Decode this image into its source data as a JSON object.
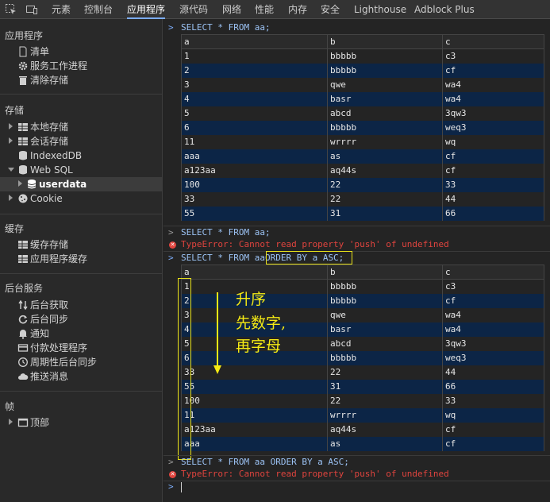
{
  "toolbar": {
    "tabs": [
      "元素",
      "控制台",
      "应用程序",
      "源代码",
      "网络",
      "性能",
      "内存",
      "安全",
      "Lighthouse",
      "Adblock Plus"
    ],
    "active_tab": "应用程序"
  },
  "sidebar": {
    "app_section": "应用程序",
    "app_items": [
      "清单",
      "服务工作进程",
      "清除存储"
    ],
    "storage_section": "存储",
    "storage_items": [
      "本地存储",
      "会话存储",
      "IndexedDB",
      "Web SQL",
      "userdata",
      "Cookie"
    ],
    "cache_section": "缓存",
    "cache_items": [
      "缓存存储",
      "应用程序缓存"
    ],
    "bg_section": "后台服务",
    "bg_items": [
      "后台获取",
      "后台同步",
      "通知",
      "付款处理程序",
      "周期性后台同步",
      "推送消息"
    ],
    "frames_section": "帧",
    "frames_items": [
      "顶部"
    ]
  },
  "console": {
    "prompt": ">",
    "cmd1": "SELECT * FROM aa;",
    "table1": {
      "headers": [
        "a",
        "b",
        "c"
      ],
      "rows": [
        [
          "1",
          "bbbbb",
          "c3"
        ],
        [
          "2",
          "bbbbb",
          "cf"
        ],
        [
          "3",
          "qwe",
          "wa4"
        ],
        [
          "4",
          "basr",
          "wa4"
        ],
        [
          "5",
          "abcd",
          "3qw3"
        ],
        [
          "6",
          "bbbbb",
          "weq3"
        ],
        [
          "11",
          "wrrrr",
          "wq"
        ],
        [
          "aaa",
          "as",
          "cf"
        ],
        [
          "a123aa",
          "aq44s",
          "cf"
        ],
        [
          "100",
          "22",
          "33"
        ],
        [
          "33",
          "22",
          "44"
        ],
        [
          "55",
          "31",
          "66"
        ]
      ]
    },
    "cmd2": "SELECT * FROM aa;",
    "error": "TypeError: Cannot read property 'push' of undefined",
    "cmd3_prefix": "SELECT * FROM aa",
    "cmd3_highlight": "ORDER BY a ASC;",
    "table2": {
      "headers": [
        "a",
        "b",
        "c"
      ],
      "rows": [
        [
          "1",
          "bbbbb",
          "c3"
        ],
        [
          "2",
          "bbbbb",
          "cf"
        ],
        [
          "3",
          "qwe",
          "wa4"
        ],
        [
          "4",
          "basr",
          "wa4"
        ],
        [
          "5",
          "abcd",
          "3qw3"
        ],
        [
          "6",
          "bbbbb",
          "weq3"
        ],
        [
          "33",
          "22",
          "44"
        ],
        [
          "55",
          "31",
          "66"
        ],
        [
          "100",
          "22",
          "33"
        ],
        [
          "11",
          "wrrrr",
          "wq"
        ],
        [
          "a123aa",
          "aq44s",
          "cf"
        ],
        [
          "aaa",
          "as",
          "cf"
        ]
      ]
    },
    "cmd4": "SELECT * FROM aa ORDER BY a ASC;",
    "error2": "TypeError: Cannot read property 'push' of undefined",
    "annotation": [
      "升序",
      "先数字,",
      "再字母"
    ]
  },
  "colors": {
    "accent": "#7cacf8",
    "error": "#e0443e",
    "annotation": "#f5ea14",
    "row_highlight": "#0c2546"
  }
}
